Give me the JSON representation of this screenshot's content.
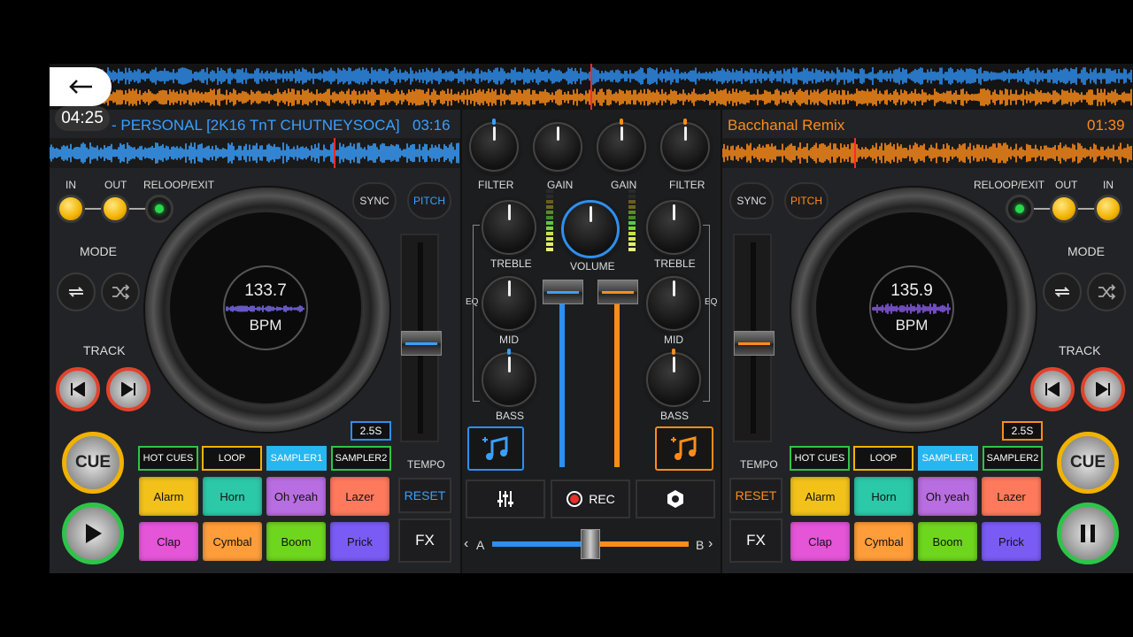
{
  "overlay": {
    "time": "04:25",
    "back_icon": "back-arrow-icon"
  },
  "deck_left": {
    "title": "- PERSONAL [2K16 TnT CHUTNEYSOCA]",
    "time": "03:16",
    "in": "IN",
    "out": "OUT",
    "reloop": "RELOOP/EXIT",
    "mode": "MODE",
    "track": "TRACK",
    "sync": "SYNC",
    "pitch": "PITCH",
    "bpm_value": "133.7",
    "bpm_unit": "BPM",
    "range": "2.5S",
    "tempo": "TEMPO",
    "reset": "RESET",
    "fx": "FX",
    "cue": "CUE",
    "tabs": [
      "HOT CUES",
      "LOOP",
      "SAMPLER1",
      "SAMPLER2"
    ],
    "pads": [
      "Alarm",
      "Horn",
      "Oh yeah",
      "Lazer",
      "Clap",
      "Cymbal",
      "Boom",
      "Prick"
    ],
    "accent": "#2d8ff0"
  },
  "deck_right": {
    "title": "Bacchanal Remix",
    "time": "01:39",
    "in": "IN",
    "out": "OUT",
    "reloop": "RELOOP/EXIT",
    "mode": "MODE",
    "track": "TRACK",
    "sync": "SYNC",
    "pitch": "PITCH",
    "bpm_value": "135.9",
    "bpm_unit": "BPM",
    "range": "2.5S",
    "tempo": "TEMPO",
    "reset": "RESET",
    "fx": "FX",
    "cue": "CUE",
    "tabs": [
      "HOT CUES",
      "LOOP",
      "SAMPLER1",
      "SAMPLER2"
    ],
    "pads": [
      "Alarm",
      "Horn",
      "Oh yeah",
      "Lazer",
      "Clap",
      "Cymbal",
      "Boom",
      "Prick"
    ],
    "accent": "#ff8c1a"
  },
  "mixer": {
    "filter": "FILTER",
    "gain": "GAIN",
    "treble": "TREBLE",
    "mid": "MID",
    "bass": "BASS",
    "eq": "EQ",
    "volume": "VOLUME",
    "rec": "REC",
    "a": "A",
    "b": "B",
    "crossfader_position": 0.5
  },
  "pad_colors": [
    "#f2c21a",
    "#2bc9a8",
    "#b86ee0",
    "#ff7a5c",
    "#e455d8",
    "#ff9d3a",
    "#6fd61e",
    "#7a5cf5"
  ]
}
